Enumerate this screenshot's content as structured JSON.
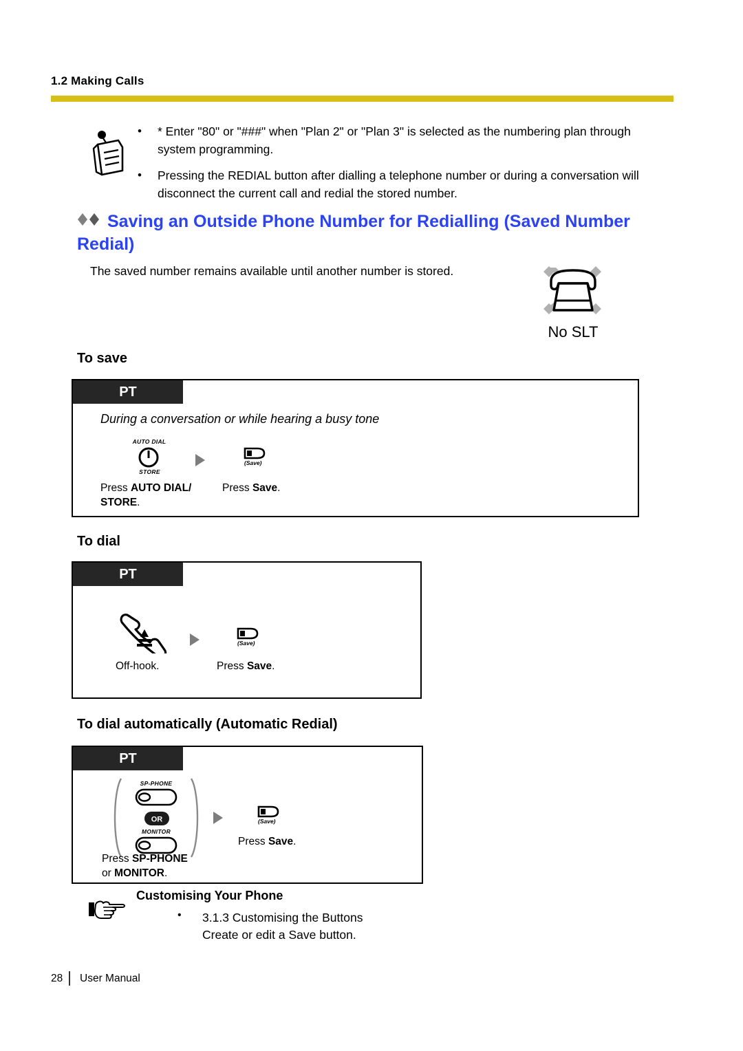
{
  "running_head": "1.2 Making Calls",
  "accent_gold": "#d6bf16",
  "heading_blue": "#2b43f0",
  "notes": {
    "icon": "note-pad-icon",
    "items": [
      "* Enter \"80\" or \"###\" when \"Plan 2\" or \"Plan 3\" is selected as the numbering plan through system programming.",
      "Pressing the REDIAL button after dialling a telephone number or during a conversation will disconnect the current call and redial the stored number."
    ]
  },
  "section": {
    "heading": "Saving an Outside Phone Number for Redialling (Saved Number Redial)",
    "intro": "The saved number remains available until another number is stored."
  },
  "no_slt": {
    "icon": "crossed-out-telephone-icon",
    "label": "No SLT"
  },
  "procedures": [
    {
      "subhead": "To save",
      "tag": "PT",
      "condition": "During a conversation or while hearing a busy tone",
      "steps": [
        {
          "icon": "auto-dial-store-key-icon",
          "key_top": "AUTO DIAL",
          "key_bottom": "STORE",
          "caption_plain_1": "Press ",
          "caption_bold": "AUTO DIAL/",
          "caption_bold_2": "STORE",
          "caption_plain_2": "."
        },
        {
          "icon": "save-key-icon",
          "key_sub": "(Save)",
          "caption_plain_1": "Press ",
          "caption_bold": "Save",
          "caption_plain_2": "."
        }
      ]
    },
    {
      "subhead": "To dial",
      "tag": "PT",
      "condition": "",
      "steps": [
        {
          "icon": "offhook-handset-icon",
          "caption_plain_1": "Off-hook.",
          "caption_bold": "",
          "caption_plain_2": ""
        },
        {
          "icon": "save-key-icon",
          "key_sub": "(Save)",
          "caption_plain_1": "Press ",
          "caption_bold": "Save",
          "caption_plain_2": "."
        }
      ]
    },
    {
      "subhead": "To dial automatically (Automatic Redial)",
      "tag": "PT",
      "condition": "",
      "steps": [
        {
          "icon": "sp-phone-or-monitor-key-icon",
          "key_top": "SP-PHONE",
          "or_label": "OR",
          "key_bottom": "MONITOR",
          "caption_plain_1": "Press ",
          "caption_bold": "SP-PHONE",
          "caption_line2_plain": "or ",
          "caption_line2_bold": "MONITOR",
          "caption_plain_2": "."
        },
        {
          "icon": "save-key-icon",
          "key_sub": "(Save)",
          "caption_plain_1": "Press ",
          "caption_bold": "Save",
          "caption_plain_2": "."
        }
      ]
    }
  ],
  "customising": {
    "icon": "pointing-hand-icon",
    "title": "Customising Your Phone",
    "bullet_line_1": "3.1.3 Customising the Buttons",
    "bullet_line_2": "Create or edit a Save button."
  },
  "footer": {
    "page_number": "28",
    "doc_title": "User Manual"
  }
}
